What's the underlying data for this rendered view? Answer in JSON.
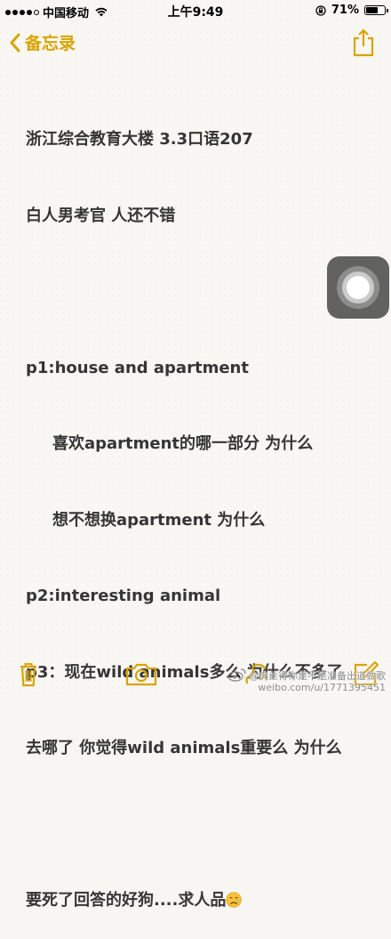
{
  "status_bar": {
    "carrier": "中国移动",
    "time": "上午9:49",
    "battery_percent": "71%",
    "battery_level": 0.71,
    "signal_bars": 4
  },
  "nav": {
    "back_label": "备忘录",
    "share_icon": "share-icon"
  },
  "note": {
    "lines": [
      "浙江综合教育大楼 3.3口语207",
      "白人男考官 人还不错",
      "",
      "p1:house and apartment",
      "喜欢apartment的哪一部分 为什么",
      "想不想换apartment 为什么",
      "p2:interesting animal",
      "p3：现在wild animals多么 为什么不多了",
      "去哪了 你觉得wild animals重要么 为什么",
      "",
      "要死了回答的好狗....求人品"
    ],
    "end_emoji": "crying-face-icon"
  },
  "toolbar": {
    "icons": [
      "trash-icon",
      "camera-icon",
      "sketch-icon",
      "compose-icon"
    ]
  },
  "watermark": {
    "handle": "@肉丝得你是不是准备出道做歌",
    "url": "weibo.com/u/1771395451"
  },
  "colors": {
    "accent": "#d9a400",
    "text": "#353535",
    "background": "#f8f7f4"
  }
}
